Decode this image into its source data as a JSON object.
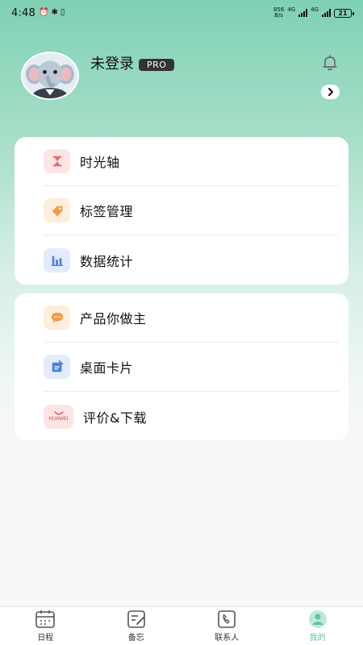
{
  "status_bar": {
    "time": "4:48",
    "speed_top": "856",
    "speed_bottom": "B/s",
    "net1": "4G",
    "net2": "4G",
    "battery": "21"
  },
  "profile": {
    "name": "未登录",
    "badge": "PRO"
  },
  "menu_group_1": [
    {
      "label": "时光轴",
      "icon": "hourglass-icon",
      "bg": "#fde5e5",
      "fg": "#f06a6a"
    },
    {
      "label": "标签管理",
      "icon": "tag-icon",
      "bg": "#fdeedd",
      "fg": "#f29a42"
    },
    {
      "label": "数据统计",
      "icon": "bar-chart-icon",
      "bg": "#e3ecfb",
      "fg": "#4f7fe8"
    }
  ],
  "menu_group_2": [
    {
      "label": "产品你做主",
      "icon": "chat-icon",
      "bg": "#fdeedd",
      "fg": "#f29a42"
    },
    {
      "label": "桌面卡片",
      "icon": "widget-card-icon",
      "bg": "#e3ecfb",
      "fg": "#4f7fe8"
    },
    {
      "label": "评价&下载",
      "icon": "huawei-appgallery-icon",
      "bg": "#fde5e5",
      "fg": "#e24848",
      "brand": "HUAWEI"
    }
  ],
  "bottom_nav": [
    {
      "label": "日程",
      "icon": "calendar-icon"
    },
    {
      "label": "备忘",
      "icon": "memo-icon"
    },
    {
      "label": "联系人",
      "icon": "contact-phone-icon"
    },
    {
      "label": "我的",
      "icon": "profile-icon",
      "active": true
    }
  ],
  "colors": {
    "accent": "#5fc59c",
    "header_gradient_top": "#7fd1b4"
  }
}
